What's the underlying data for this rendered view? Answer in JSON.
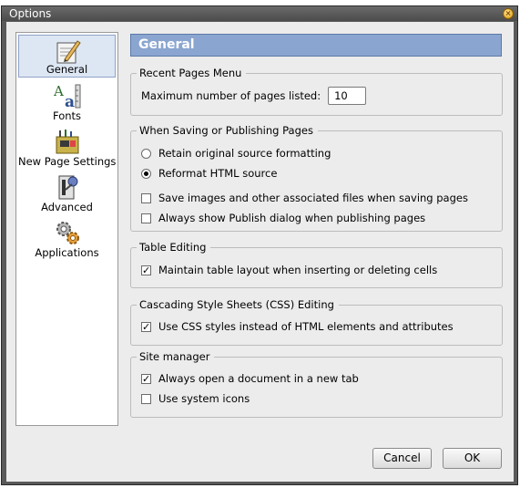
{
  "window": {
    "title": "Options"
  },
  "sidebar": {
    "items": [
      {
        "label": "General",
        "icon": "general-icon",
        "selected": true
      },
      {
        "label": "Fonts",
        "icon": "fonts-icon",
        "selected": false
      },
      {
        "label": "New Page Settings",
        "icon": "new-page-settings-icon",
        "selected": false
      },
      {
        "label": "Advanced",
        "icon": "advanced-icon",
        "selected": false
      },
      {
        "label": "Applications",
        "icon": "applications-icon",
        "selected": false
      }
    ]
  },
  "page": {
    "title": "General",
    "recent_pages": {
      "legend": "Recent Pages Menu",
      "max_label": "Maximum number of pages listed:",
      "max_value": "10"
    },
    "saving": {
      "legend": "When Saving or Publishing Pages",
      "retain_label": "Retain original source formatting",
      "retain_selected": false,
      "reformat_label": "Reformat HTML source",
      "reformat_selected": true,
      "save_images_label": "Save images and other associated files when saving pages",
      "save_images_checked": false,
      "publish_dialog_label": "Always show Publish dialog when publishing pages",
      "publish_dialog_checked": false
    },
    "table_editing": {
      "legend": "Table Editing",
      "maintain_label": "Maintain table layout when inserting or deleting cells",
      "maintain_checked": true
    },
    "css_editing": {
      "legend": "Cascading Style Sheets (CSS) Editing",
      "use_css_label": "Use CSS styles instead of HTML elements and attributes",
      "use_css_checked": true
    },
    "site_manager": {
      "legend": "Site manager",
      "new_tab_label": "Always open a document in a new tab",
      "new_tab_checked": true,
      "system_icons_label": "Use system icons",
      "system_icons_checked": false
    }
  },
  "buttons": {
    "cancel": "Cancel",
    "ok": "OK"
  },
  "colors": {
    "header_bg": "#8aa5cf",
    "selected_item_bg": "#dde6f3",
    "dialog_bg": "#ececec",
    "titlebar_bg": "#555555"
  }
}
